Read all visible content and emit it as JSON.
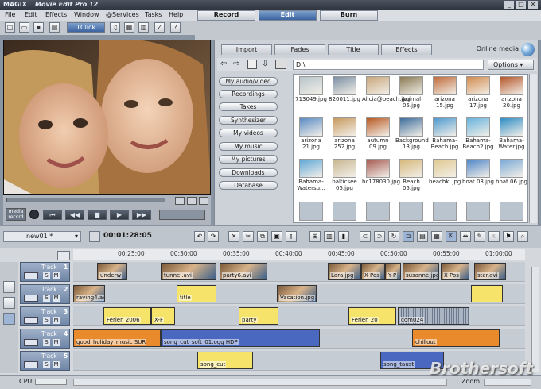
{
  "app": {
    "logo": "MAGIX",
    "title": "Movie Edit Pro 12"
  },
  "menu": [
    "File",
    "Edit",
    "Effects",
    "Window",
    "@Services",
    "Tasks",
    "Help"
  ],
  "modes": [
    {
      "label": "Record",
      "active": false
    },
    {
      "label": "Edit",
      "active": true
    },
    {
      "label": "Burn",
      "active": false
    }
  ],
  "toolbar": {
    "oneclick_label": "1Click"
  },
  "media": {
    "tabs": [
      "Import",
      "Fades",
      "Title",
      "Effects"
    ],
    "online_media": "Online media",
    "path": "D:\\",
    "options": "Options",
    "categories": [
      "My audio/video",
      "Recordings",
      "Takes",
      "Synthesizer",
      "My videos",
      "My music",
      "My pictures",
      "Downloads",
      "Database"
    ],
    "files": [
      {
        "name": "713049.jpg",
        "color": "#b7c4c9"
      },
      {
        "name": "820011.jpg",
        "color": "#7b8fa3"
      },
      {
        "name": "Alicia@beach.jpg",
        "color": "#c9a77c"
      },
      {
        "name": "Animal 05.jpg",
        "color": "#8a7a55"
      },
      {
        "name": "arizona 15.jpg",
        "color": "#c06a3a"
      },
      {
        "name": "arizona 17.jpg",
        "color": "#d28c4e"
      },
      {
        "name": "arizona 20.jpg",
        "color": "#b4562a"
      },
      {
        "name": "arizona 21.jpg",
        "color": "#5a8cc4"
      },
      {
        "name": "arizona 252.jpg",
        "color": "#c79a5e"
      },
      {
        "name": "autumn 09.jpg",
        "color": "#b85a22"
      },
      {
        "name": "Background 13.jpg",
        "color": "#3f6e9c"
      },
      {
        "name": "Bahama-Beach.jpg",
        "color": "#4d9ad0"
      },
      {
        "name": "Bahama-Beach2.jpg",
        "color": "#67b3de"
      },
      {
        "name": "Bahama-Water.jpg",
        "color": "#2f8dc4"
      },
      {
        "name": "Bahama-Watersu...",
        "color": "#5fa8d8"
      },
      {
        "name": "balticsee 05.jpg",
        "color": "#c8b691"
      },
      {
        "name": "bc178030.jpg",
        "color": "#a65a52"
      },
      {
        "name": "Beach 05.jpg",
        "color": "#d6b87a"
      },
      {
        "name": "beachkl.jpg",
        "color": "#e0c890"
      },
      {
        "name": "boat 03.jpg",
        "color": "#4f86c8"
      },
      {
        "name": "boat 06.jpg",
        "color": "#7aa9d6"
      }
    ]
  },
  "preview": {
    "mode_label": "media\nrecord"
  },
  "timeline": {
    "project": "new01 *",
    "timecode": "00:01:28:05",
    "ruler": [
      "00:25:00",
      "00:30:00",
      "00:35:00",
      "00:40:00",
      "00:45:00",
      "00:50:00",
      "00:55:00",
      "01:00:00"
    ],
    "tracks": [
      {
        "num": "1",
        "label": "Track",
        "clips": [
          {
            "name": "underw",
            "type": "photo"
          },
          {
            "name": "tunnel.avi",
            "type": "photo"
          },
          {
            "name": "party6.avi",
            "type": "photo"
          },
          {
            "name": "Lara.jpg",
            "type": "photo"
          },
          {
            "name": "X-Pos",
            "type": "photo"
          },
          {
            "name": "Y-P",
            "type": "photo"
          },
          {
            "name": "susanne.jpg",
            "type": "photo"
          },
          {
            "name": "X-Pos",
            "type": "photo"
          },
          {
            "name": "star.avi",
            "type": "photo"
          }
        ]
      },
      {
        "num": "2",
        "label": "Track",
        "clips": [
          {
            "name": "raving4.avi",
            "type": "photo"
          },
          {
            "name": "title",
            "type": "yellow"
          },
          {
            "name": "Vacation.jpg",
            "type": "photo"
          },
          {
            "name": "",
            "type": "yellow"
          }
        ]
      },
      {
        "num": "3",
        "label": "Track",
        "clips": [
          {
            "name": "Ferien 2006",
            "type": "yellow"
          },
          {
            "name": "X-F",
            "type": "yellow"
          },
          {
            "name": "party",
            "type": "yellow"
          },
          {
            "name": "Ferien 20",
            "type": "yellow"
          },
          {
            "name": "com024",
            "type": "wave"
          }
        ]
      },
      {
        "num": "4",
        "label": "Track",
        "clips": [
          {
            "name": "good_holiday_music SUR",
            "type": "orange"
          },
          {
            "name": "song_cut_soft_01.ogg HDP",
            "type": "blue"
          },
          {
            "name": "chillout",
            "type": "orange"
          }
        ]
      },
      {
        "num": "5",
        "label": "Track",
        "clips": [
          {
            "name": "song_cut",
            "type": "yellow"
          },
          {
            "name": "song_taust",
            "type": "blue"
          }
        ]
      }
    ],
    "cpu_label": "CPU:",
    "zoom_label": "Zoom"
  },
  "watermark": "Brothersoft"
}
